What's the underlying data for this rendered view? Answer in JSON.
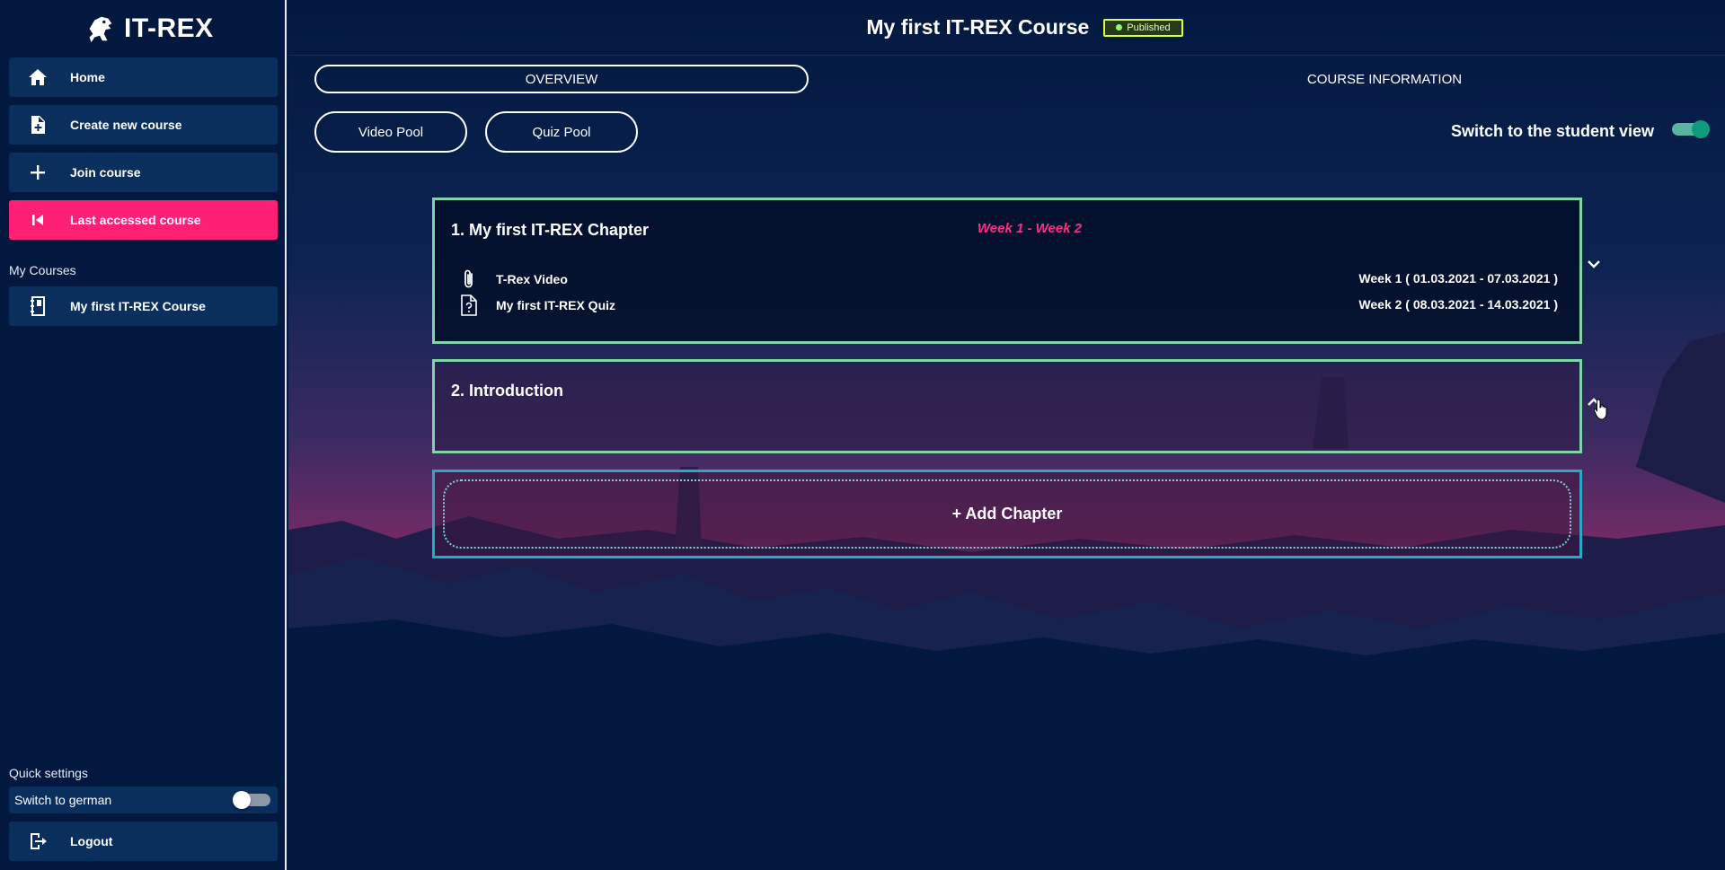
{
  "app": {
    "name": "IT-REX"
  },
  "sidebar": {
    "items": [
      {
        "label": "Home",
        "icon": "home-icon"
      },
      {
        "label": "Create new course",
        "icon": "file-plus-icon"
      },
      {
        "label": "Join course",
        "icon": "plus-icon"
      },
      {
        "label": "Last accessed course",
        "icon": "skip-back-icon"
      }
    ],
    "my_courses_label": "My Courses",
    "courses": [
      {
        "label": "My first IT-REX Course",
        "icon": "notebook-icon"
      }
    ],
    "quick_settings_label": "Quick settings",
    "german_toggle_label": "Switch to german",
    "german_toggle_on": false,
    "logout_label": "Logout"
  },
  "header": {
    "course_title": "My first IT-REX Course",
    "status_badge": "Published"
  },
  "tabs": [
    {
      "label": "OVERVIEW",
      "selected": true
    },
    {
      "label": "COURSE INFORMATION",
      "selected": false
    }
  ],
  "pools": {
    "video_label": "Video Pool",
    "quiz_label": "Quiz Pool"
  },
  "student_view": {
    "label": "Switch to the student view",
    "on": true
  },
  "chapters": [
    {
      "title": "1. My first IT-REX Chapter",
      "weeks": "Week 1 - Week 2",
      "items": [
        {
          "label": "T-Rex Video",
          "icon": "paperclip-icon",
          "date": "Week 1 ( 01.03.2021 - 07.03.2021 )"
        },
        {
          "label": "My first IT-REX Quiz",
          "icon": "quiz-file-icon",
          "date": "Week 2 ( 08.03.2021 - 14.03.2021 )"
        }
      ],
      "expanded": true
    },
    {
      "title": "2. Introduction",
      "weeks": "",
      "items": [],
      "expanded": false
    }
  ],
  "add_chapter_label": "+ Add Chapter",
  "colors": {
    "background": "#02183f",
    "nav": "#0a2f5c",
    "accent": "#ff1f75",
    "chapter_border": "#7fd4a9",
    "add_border": "#2aa7c6",
    "badge": "#d8ff45",
    "toggle_on": "#0e9b7f"
  }
}
